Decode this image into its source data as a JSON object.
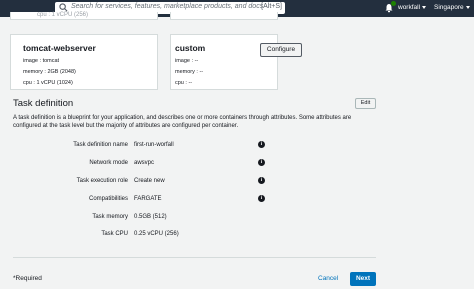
{
  "topbar": {
    "search_placeholder": "Search for services, features, marketplace products, and docs",
    "search_shortcut": "[Alt+S]",
    "user": "workfall",
    "region": "Singapore",
    "colors": {
      "bar": "#232f3e",
      "notification_dot": "#1d8102"
    }
  },
  "cards": {
    "previous_cut_text": "cpu : 1 vCPU (256)",
    "card1": {
      "title": "tomcat-webserver",
      "image": "image : tomcat",
      "memory": "memory : 2GB (2048)",
      "cpu": "cpu : 1 vCPU (1024)"
    },
    "card2": {
      "title": "custom",
      "image": "image : --",
      "memory": "memory : --",
      "cpu": "cpu : --",
      "configure_label": "Configure"
    }
  },
  "task_definition": {
    "title": "Task definition",
    "edit_label": "Edit",
    "description": "A task definition is a blueprint for your application, and describes one or more containers through attributes. Some attributes are configured at the task level but the majority of attributes are configured per container.",
    "rows": [
      {
        "label": "Task definition name",
        "value": "first-run-worfall",
        "info": true
      },
      {
        "label": "Network mode",
        "value": "awsvpc",
        "info": true
      },
      {
        "label": "Task execution role",
        "value": "Create new",
        "info": true
      },
      {
        "label": "Compatibilities",
        "value": "FARGATE",
        "info": true
      },
      {
        "label": "Task memory",
        "value": "0.5GB (512)",
        "info": false
      },
      {
        "label": "Task CPU",
        "value": "0.25 vCPU (256)",
        "info": false
      }
    ]
  },
  "footer": {
    "required": "*Required",
    "cancel": "Cancel",
    "next": "Next",
    "colors": {
      "primary": "#0073bb"
    }
  }
}
